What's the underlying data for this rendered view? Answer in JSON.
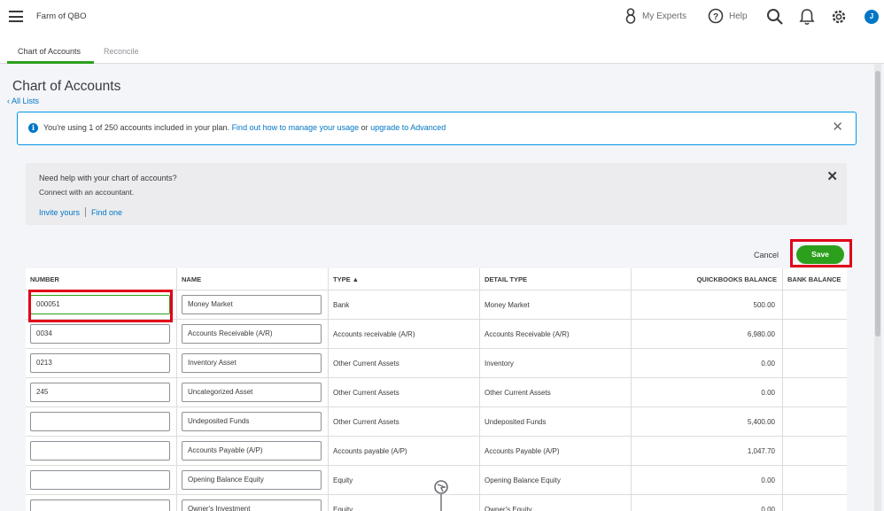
{
  "topbar": {
    "company": "Farm of QBO",
    "my_experts": "My Experts",
    "help": "Help",
    "avatar_initial": "J"
  },
  "tabs": [
    {
      "label": "Chart of Accounts",
      "active": true
    },
    {
      "label": "Reconcile",
      "active": false
    }
  ],
  "page": {
    "title": "Chart of Accounts",
    "back_link": "All Lists"
  },
  "info_banner": {
    "text": "You're using 1 of 250 accounts included in your plan.",
    "link1": "Find out how to manage your usage",
    "or": "or",
    "link2": "upgrade to Advanced"
  },
  "help_card": {
    "title": "Need help with your chart of accounts?",
    "subtitle": "Connect with an accountant.",
    "link_invite": "Invite yours",
    "link_find": "Find one"
  },
  "actions": {
    "cancel": "Cancel",
    "save": "Save"
  },
  "table": {
    "headers": [
      "NUMBER",
      "NAME",
      "TYPE ▲",
      "DETAIL TYPE",
      "QUICKBOOKS BALANCE",
      "BANK BALANCE"
    ],
    "rows": [
      {
        "number": "000051",
        "name": "Money Market",
        "type": "Bank",
        "detail": "Money Market",
        "qb_balance": "500.00",
        "bank_balance": ""
      },
      {
        "number": "0034",
        "name": "Accounts Receivable (A/R)",
        "type": "Accounts receivable (A/R)",
        "detail": "Accounts Receivable (A/R)",
        "qb_balance": "6,980.00",
        "bank_balance": ""
      },
      {
        "number": "0213",
        "name": "Inventory Asset",
        "type": "Other Current Assets",
        "detail": "Inventory",
        "qb_balance": "0.00",
        "bank_balance": ""
      },
      {
        "number": "245",
        "name": "Uncategorized Asset",
        "type": "Other Current Assets",
        "detail": "Other Current Assets",
        "qb_balance": "0.00",
        "bank_balance": ""
      },
      {
        "number": "",
        "name": "Undeposited Funds",
        "type": "Other Current Assets",
        "detail": "Undeposited Funds",
        "qb_balance": "5,400.00",
        "bank_balance": ""
      },
      {
        "number": "",
        "name": "Accounts Payable (A/P)",
        "type": "Accounts payable (A/P)",
        "detail": "Accounts Payable (A/P)",
        "qb_balance": "1,047.70",
        "bank_balance": ""
      },
      {
        "number": "",
        "name": "Opening Balance Equity",
        "type": "Equity",
        "detail": "Opening Balance Equity",
        "qb_balance": "0.00",
        "bank_balance": ""
      },
      {
        "number": "",
        "name": "Owner's Investment",
        "type": "Equity",
        "detail": "Owner's Equity",
        "qb_balance": "0.00",
        "bank_balance": ""
      }
    ]
  },
  "colors": {
    "brand_green": "#2ca01c",
    "link_blue": "#0077c5",
    "highlight_red": "#e0001a"
  },
  "icons": [
    "hamburger-icon",
    "experts-icon",
    "help-icon",
    "search-icon",
    "bell-icon",
    "gear-icon",
    "info-icon",
    "close-icon",
    "cursor-icon"
  ]
}
